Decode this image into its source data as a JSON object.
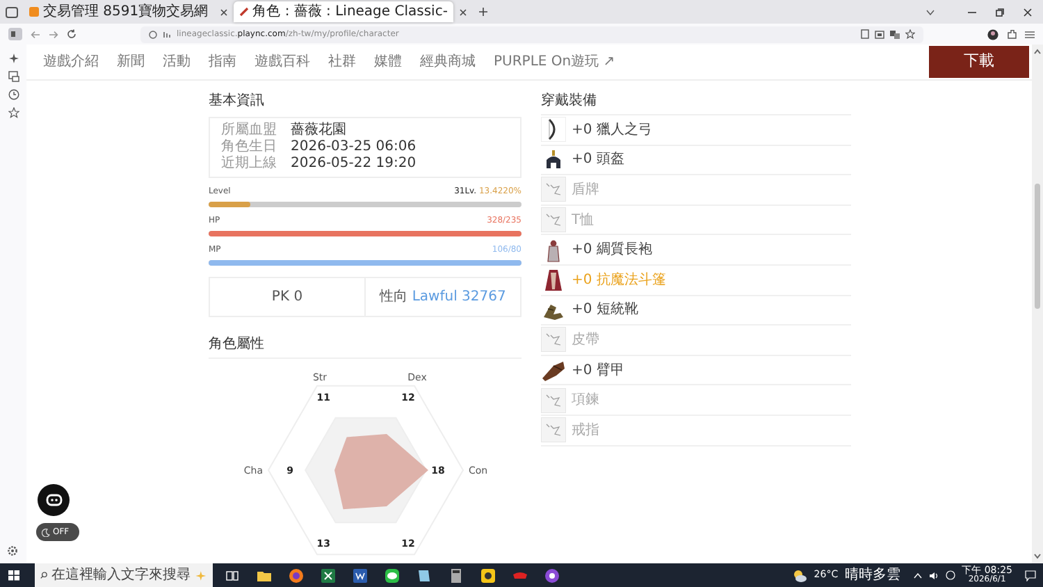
{
  "browser": {
    "tabs": [
      {
        "title": "交易管理 8591寶物交易網",
        "selected": false
      },
      {
        "title": "角色 : 薔薇 : Lineage Classic-",
        "selected": true
      }
    ],
    "url": "lineageclassic.**plaync.com**/zh-tw/my/profile/character"
  },
  "nav": {
    "items": [
      "遊戲介紹",
      "新聞",
      "活動",
      "指南",
      "遊戲百科",
      "社群",
      "媒體",
      "經典商城",
      "PURPLE On遊玩 ↗"
    ],
    "download": "下載"
  },
  "basic_info": {
    "title": "基本資訊",
    "rows": [
      {
        "label": "所屬血盟",
        "value": "薔薇花園"
      },
      {
        "label": "角色生日",
        "value": "2026-03-25 06:06"
      },
      {
        "label": "近期上線",
        "value": "2026-05-22 19:20"
      }
    ]
  },
  "bars": [
    {
      "label": "Level",
      "value": "31Lv.",
      "reading": "13.4220%",
      "level": 0.134,
      "color": "#d9a048"
    },
    {
      "label": "HP",
      "reading": "328/235",
      "level": 1,
      "color": "#e8735f"
    },
    {
      "label": "MP",
      "reading": "106/80",
      "level": 1,
      "color": "#8fb9ee"
    }
  ],
  "pk": "PK 0",
  "alignment_label": "性向",
  "alignment": "Lawful 32767",
  "attributes": {
    "title": "角色屬性",
    "stats": [
      {
        "label": "Str",
        "value": "11"
      },
      {
        "label": "Dex",
        "value": "12"
      },
      {
        "label": "Con",
        "value": "18"
      },
      {
        "value": "12"
      },
      {
        "value": "13"
      },
      {
        "label": "Cha",
        "value": "9"
      }
    ]
  },
  "equipment": {
    "title": "穿戴裝備",
    "items": [
      {
        "kind": "equipped",
        "name": "+0 獵人之弓",
        "color": "#444444"
      },
      {
        "kind": "equipped",
        "name": "+0 頭盔",
        "color": "#444444"
      },
      {
        "kind": "empty",
        "name": "盾牌"
      },
      {
        "kind": "empty",
        "name": "T恤"
      },
      {
        "kind": "equipped",
        "name": "+0 綢質長袍",
        "color": "#444444"
      },
      {
        "kind": "equipped",
        "name": "+0 抗魔法斗篷",
        "color": "#eaa21c"
      },
      {
        "kind": "equipped",
        "name": "+0 短統靴",
        "color": "#444444"
      },
      {
        "kind": "empty",
        "name": "皮帶"
      },
      {
        "kind": "equipped",
        "name": "+0 臂甲",
        "color": "#444444"
      },
      {
        "kind": "empty",
        "name": "項鍊"
      },
      {
        "kind": "empty",
        "name": "戒指"
      }
    ]
  },
  "toggle": "OFF",
  "taskbar": {
    "search_placeholder": "在這裡輸入文字來搜尋",
    "temperature": "26°C",
    "weather": "晴時多雲",
    "time": "下午 08:25",
    "date": "2026/6/1"
  }
}
